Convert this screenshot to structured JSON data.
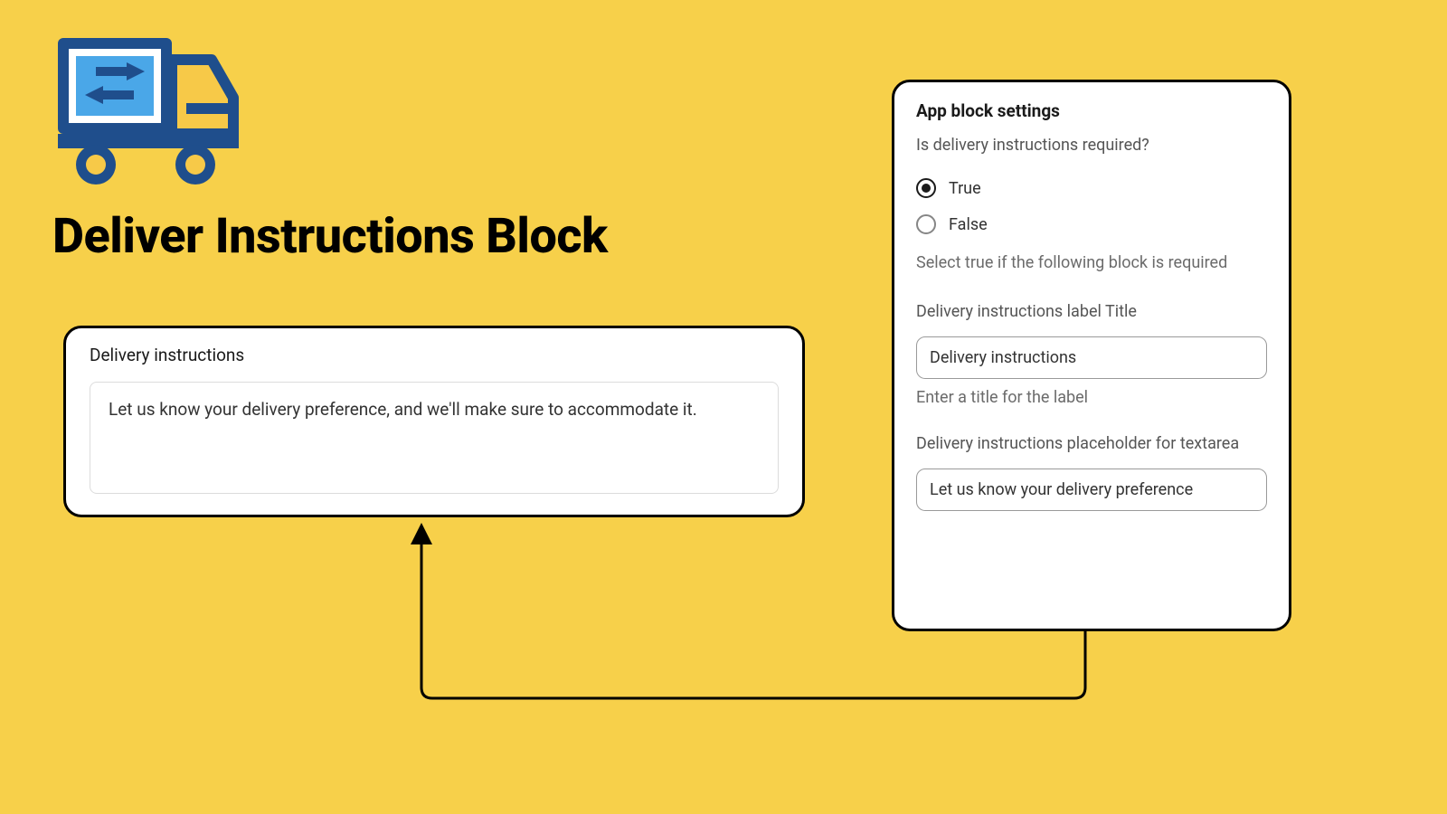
{
  "headline": "Deliver Instructions Block",
  "preview": {
    "label": "Delivery instructions",
    "placeholder": "Let us know your delivery preference, and we'll make sure to accommodate it."
  },
  "settings": {
    "title": "App block settings",
    "question": "Is delivery instructions required?",
    "option_true": "True",
    "option_false": "False",
    "required_helper": "Select true if the following block is required",
    "label_title_label": "Delivery instructions label Title",
    "label_title_value": "Delivery instructions",
    "label_title_helper": "Enter a title for the label",
    "placeholder_label": "Delivery instructions placeholder for textarea",
    "placeholder_value": "Let us know your delivery preference"
  },
  "icons": {
    "truck": "delivery-truck-icon"
  },
  "colors": {
    "bg": "#f7d04a",
    "navy": "#1f4e8c",
    "yellow": "#f7c948",
    "sky": "#4aa7e8"
  }
}
